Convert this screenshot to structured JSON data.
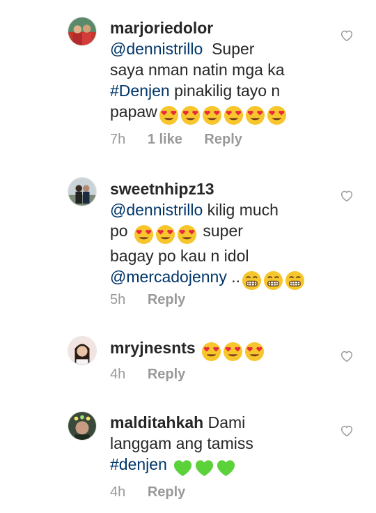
{
  "comments": [
    {
      "username": "marjoriedolor",
      "mention": "@dennistrillo",
      "text_lines": [
        "Super",
        "saya nman natin mga ka"
      ],
      "hashtag": "#Denjen",
      "text_after_hashtag": " pinakilig tayo n",
      "last_text": "papaw",
      "emoji_name": "heart-eyes-emoji",
      "time": "7h",
      "likes": "1 like",
      "reply": "Reply"
    },
    {
      "username": "sweetnhipz13",
      "mention": "@dennistrillo",
      "text1": " kilig much",
      "text2": "po ",
      "text3": " super",
      "text4": "bagay po kau n idol",
      "mention2": "@mercadojenny",
      "text5": " ..",
      "emoji_name": "heart-eyes-emoji",
      "emoji_name2": "grimacing-emoji",
      "time": "5h",
      "reply": "Reply"
    },
    {
      "username": "mryjnesnts",
      "emoji_name": "heart-eyes-emoji",
      "time": "4h",
      "reply": "Reply"
    },
    {
      "username": "malditahkah",
      "text1": " Dami",
      "text2": "langgam ang tamiss",
      "hashtag": "#denjen",
      "emoji_name": "green-heart-emoji",
      "time": "4h",
      "reply": "Reply"
    }
  ],
  "like_icon": "heart-outline-icon",
  "colors": {
    "link": "#003569",
    "meta": "#999999",
    "emoji_yellow": "#f7c62c",
    "emoji_heart": "#e8283f",
    "green_heart": "#5bd13a"
  }
}
